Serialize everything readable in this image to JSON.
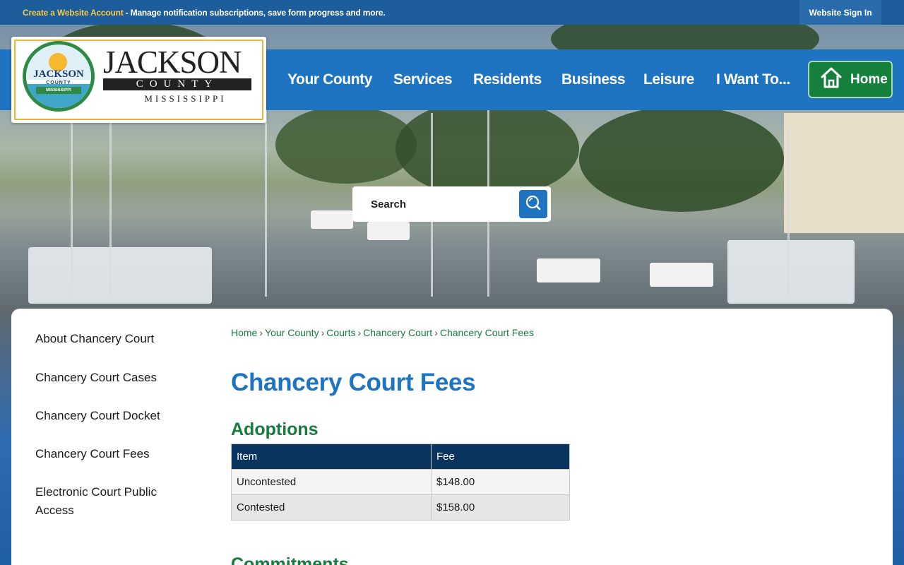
{
  "topbar": {
    "create_account_label": "Create a Website Account",
    "message": " - Manage notification subscriptions, save form progress and more.",
    "signin_label": "Website Sign In"
  },
  "logo": {
    "seal_name": "JACKSON",
    "seal_county": "COUNTY",
    "seal_state": "MISSISSIPPI",
    "wordmark_name": "JACKSON",
    "wordmark_county": "COUNTY",
    "wordmark_state": "MISSISSIPPI"
  },
  "nav": {
    "items": [
      "Your County",
      "Services",
      "Residents",
      "Business",
      "Leisure",
      "I Want To..."
    ],
    "home_label": "Home"
  },
  "search": {
    "placeholder": "Search",
    "icon": "search-icon"
  },
  "sidebar": {
    "items": [
      "About Chancery Court",
      "Chancery Court Cases",
      "Chancery Court Docket",
      "Chancery Court Fees",
      "Electronic Court Public Access"
    ]
  },
  "breadcrumb": {
    "items": [
      "Home",
      "Your County",
      "Courts",
      "Chancery Court",
      "Chancery Court Fees"
    ],
    "separator": "›"
  },
  "main": {
    "title": "Chancery Court Fees",
    "sections": [
      {
        "heading": "Adoptions",
        "table": {
          "columns": [
            "Item",
            "Fee"
          ],
          "rows": [
            [
              "Uncontested",
              "$148.00"
            ],
            [
              "Contested",
              "$158.00"
            ]
          ]
        }
      },
      {
        "heading": "Commitments"
      }
    ]
  },
  "colors": {
    "topbar": "#1d5d9c",
    "nav": "#1f74c2",
    "home_button": "#15803b",
    "title": "#1f74c2",
    "section_heading": "#187a3d",
    "table_header": "#08345e"
  }
}
